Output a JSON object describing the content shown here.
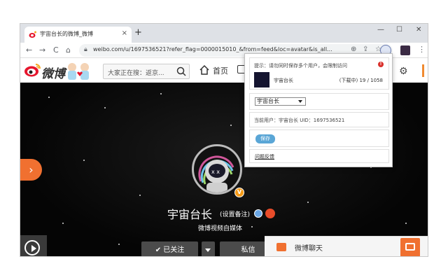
{
  "browser": {
    "tab_title": "宇宙台长的微博_微博",
    "tab_close": "×",
    "new_tab": "+",
    "win_min": "—",
    "win_max": "☐",
    "win_close": "✕",
    "back": "←",
    "forward": "→",
    "reload": "C",
    "home": "⌂",
    "url": "weibo.com/u/1697536521?refer_flag=0000015010_&from=feed&loc=avatar&is_all...",
    "menu": "⋮"
  },
  "header": {
    "logo_text": "微博",
    "search_placeholder": "大家正在搜：返京...",
    "home_label": "首页"
  },
  "profile": {
    "username": "宇宙台长",
    "set_remark": "(设置备注)",
    "bio": "微博视频自媒体",
    "verified_mark": "V",
    "followed_label": "✔ 已关注",
    "message_label": "私信"
  },
  "side": {
    "arrow": "›"
  },
  "chat": {
    "label": "微博聊天"
  },
  "popup": {
    "hint": "提示：请勿同时保存多个用户，会限制访问",
    "alert_mark": "!",
    "user_name": "宇宙台长",
    "progress": "(下载中) 19 / 1058",
    "select_value": "宇宙台长",
    "current_user": "当前用户：宇宙台长 UID：1697536521",
    "save_label": "保存",
    "feedback_label": "问题反馈"
  },
  "colors": {
    "weibo_orange": "#f07030",
    "button_gray": "#4b4b4b",
    "save_blue": "#5aa6d6"
  }
}
